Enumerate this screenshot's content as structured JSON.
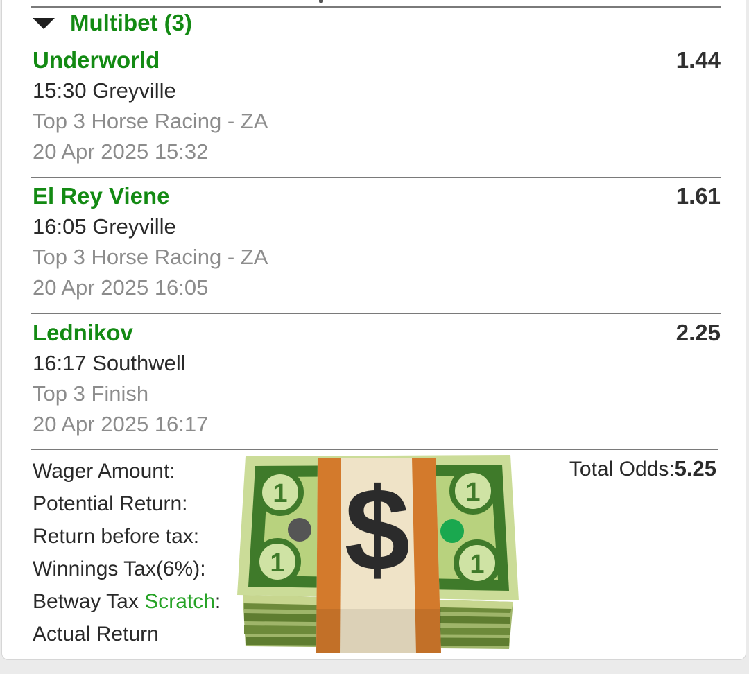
{
  "section": {
    "title": "Multibet (3)"
  },
  "legs": [
    {
      "selection": "Underworld",
      "odds": "1.44",
      "event": "15:30 Greyville",
      "market": "Top 3 Horse Racing - ZA",
      "date": "20 Apr 2025 15:32"
    },
    {
      "selection": "El Rey Viene",
      "odds": "1.61",
      "event": "16:05 Greyville",
      "market": "Top 3 Horse Racing - ZA",
      "date": "20 Apr 2025 16:05"
    },
    {
      "selection": "Lednikov",
      "odds": "2.25",
      "event": "16:17 Southwell",
      "market": "Top 3 Finish",
      "date": "20 Apr 2025 16:17"
    }
  ],
  "summary": {
    "wager_amount_label": "Wager Amount:",
    "potential_return_label": "Potential Return:",
    "return_before_tax_label": "Return before tax:",
    "winnings_tax_label": "Winnings Tax(6%):",
    "betway_tax_prefix": "Betway Tax ",
    "betway_tax_link": "Scratch",
    "betway_tax_suffix": ":",
    "actual_return_label": "Actual Return",
    "total_odds_label": "Total Odds:",
    "total_odds_value": "5.25"
  },
  "overlay": {
    "icon": "money-bag-stack-icon",
    "symbol": "$",
    "denomination": "1"
  },
  "colors": {
    "accent_green": "#138a13",
    "link_green": "#27a327",
    "text_dark": "#2a2a2a",
    "text_muted": "#8c8c8c"
  }
}
